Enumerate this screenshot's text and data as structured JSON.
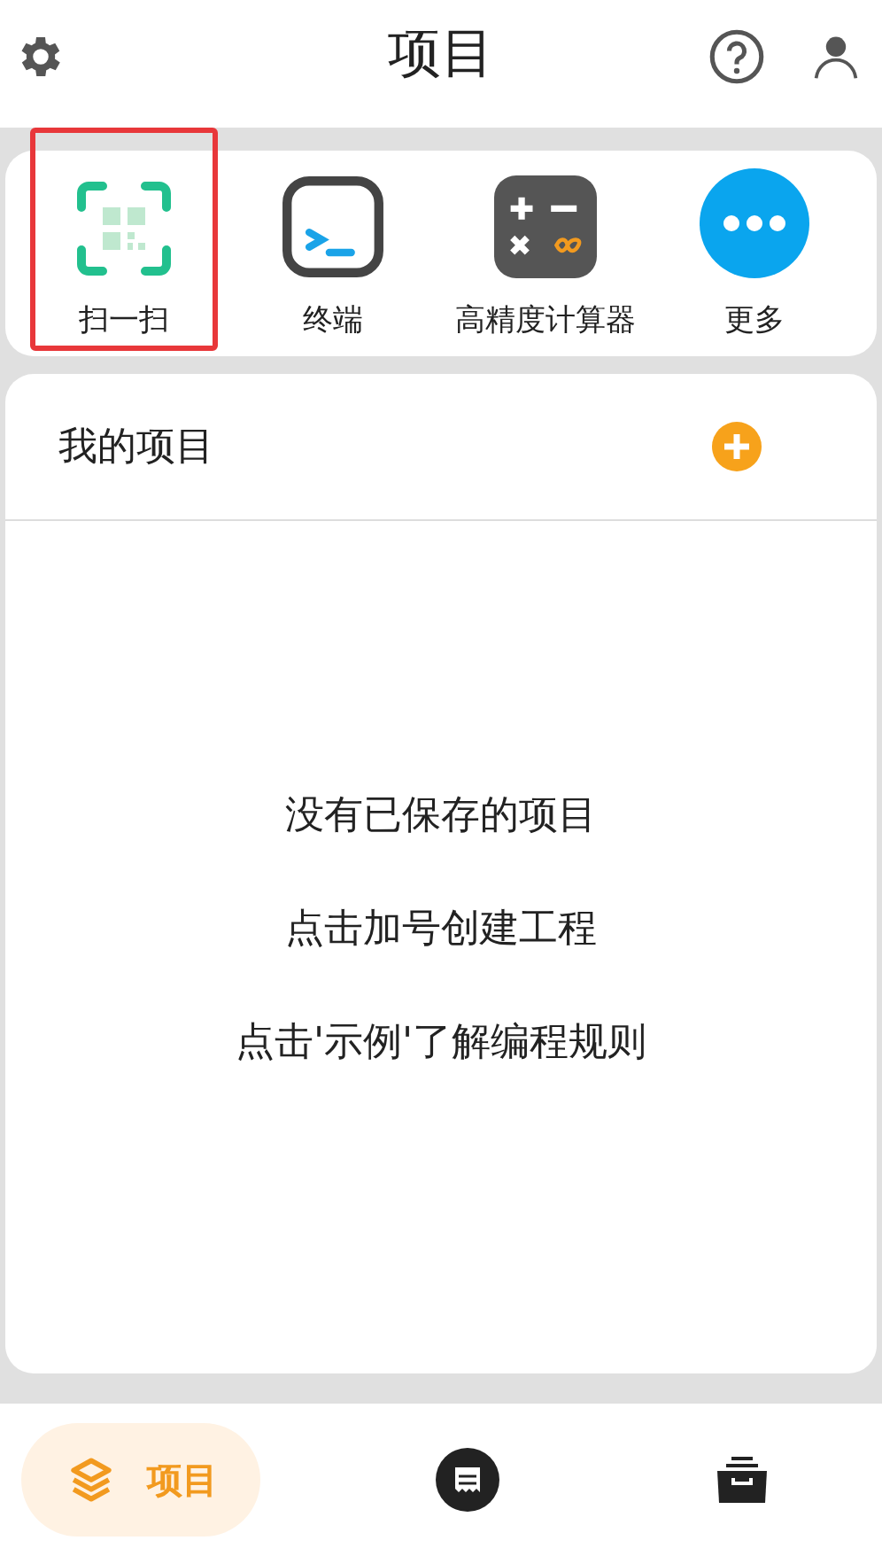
{
  "header": {
    "title": "项目"
  },
  "quick_actions": [
    {
      "kind": "qr",
      "label": "扫一扫",
      "selected": true
    },
    {
      "kind": "terminal",
      "label": "终端",
      "selected": false
    },
    {
      "kind": "calculator",
      "label": "高精度计算器",
      "selected": false
    },
    {
      "kind": "more",
      "label": "更多",
      "selected": false
    }
  ],
  "projects": {
    "title": "我的项目",
    "empty_messages": [
      "没有已保存的项目",
      "点击加号创建工程",
      "点击'示例'了解编程规则"
    ]
  },
  "bottom_nav": [
    {
      "kind": "layers",
      "label": "项目",
      "selected": true
    },
    {
      "kind": "chat",
      "selected": false
    },
    {
      "kind": "archive",
      "selected": false
    }
  ]
}
